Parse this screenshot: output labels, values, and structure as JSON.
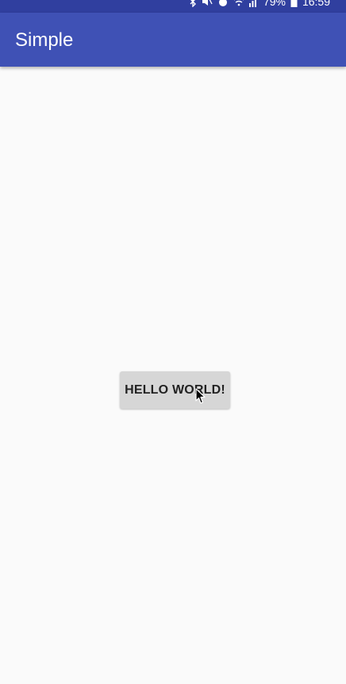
{
  "status_bar": {
    "battery_percent": "79%",
    "time": "16:59",
    "icons": [
      "bluetooth-icon",
      "mute-icon",
      "alarm-icon",
      "wifi-icon",
      "signal-icon",
      "battery-icon"
    ],
    "color": "#303f9f"
  },
  "app_bar": {
    "title": "Simple",
    "color": "#3f51b5"
  },
  "main": {
    "button_label": "HELLO WORLD!"
  },
  "colors": {
    "background": "#fafafa",
    "button": "#d6d6d6"
  }
}
